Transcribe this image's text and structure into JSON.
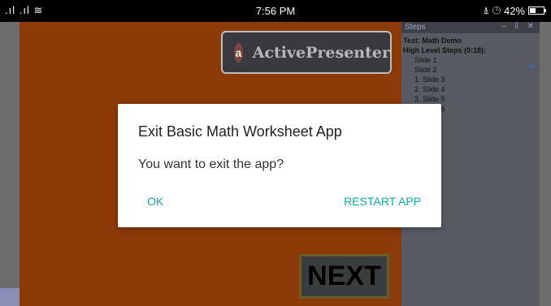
{
  "status_bar": {
    "signal": ".ıl .ıl ≋",
    "time": "7:56 PM",
    "icons": "⍋ ◷",
    "battery": "42%",
    "battery_level": 0.42
  },
  "slide": {
    "logo_mark": "a",
    "logo_text": "ActivePresenter",
    "next_label": "NEXT"
  },
  "steps_panel": {
    "title": "Steps",
    "controls": "– ⇩ ✕",
    "test_name": "Test: Math Demo",
    "high_level": "High Level Steps (0:18):",
    "items": [
      "Slide 1",
      "Slide 2",
      "1. Slide 3",
      "2. Slide 4",
      "3. Slide 5",
      "4. Slide 6"
    ]
  },
  "dialog": {
    "title": "Exit Basic Math Worksheet App",
    "message": "You want to exit the app?",
    "ok_label": "OK",
    "restart_label": "RESTART APP"
  },
  "colors": {
    "accent": "#12a89d",
    "slide_background": "#8c3a08"
  }
}
